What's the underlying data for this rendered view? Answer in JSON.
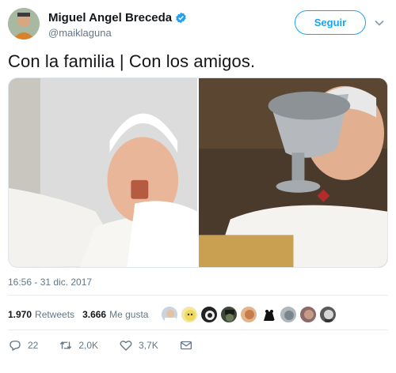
{
  "user": {
    "display_name": "Miguel Angel Breceda",
    "handle": "@maiklaguna",
    "verified_icon": "verified-badge-icon",
    "follow_label": "Seguir",
    "accent": "#1da1f2"
  },
  "tweet": {
    "text": "Con la familia | Con los amigos.",
    "timestamp": "16:56 - 31 dic. 2017"
  },
  "stats": {
    "retweets_count": "1.970",
    "retweets_label": "Retweets",
    "likes_count": "3.666",
    "likes_label": "Me gusta",
    "liker_avatars": 9
  },
  "actions": {
    "reply_count": "22",
    "retweet_count": "2,0K",
    "like_count": "3,7K"
  }
}
